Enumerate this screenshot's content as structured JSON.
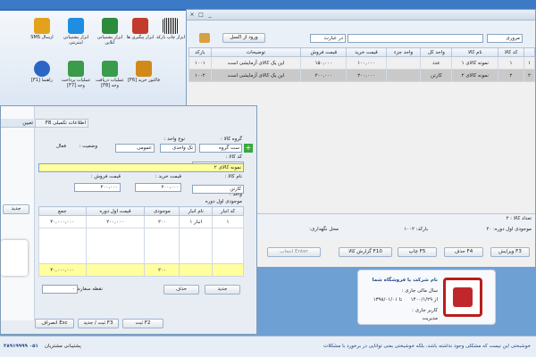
{
  "ribbon": {
    "items": [
      {
        "label": "ابزار پشتیبانی اینترنتی",
        "icon": "teamviewer-icon",
        "color": "#1f8de0"
      },
      {
        "label": "ارسال SMS",
        "icon": "sms-icon",
        "color": "#e3a21b"
      },
      {
        "label": "ابزار پشتیبانی آنلاین",
        "icon": "support-icon",
        "color": "#2c8b3c"
      },
      {
        "label": "ابزار پیگیری ها",
        "icon": "calendar-icon",
        "color": "#c23b2b"
      },
      {
        "label": "ابزار چاپ بارکد",
        "icon": "barcode-icon",
        "color": "#333333"
      },
      {
        "label": "راهنما [F1]",
        "icon": "help-icon",
        "color": "#2b66c4"
      },
      {
        "label": "عملیات پرداخت وجه [F7]",
        "icon": "payment-icon",
        "color": "#3a9b4a"
      },
      {
        "label": "عملیات دریافت وجه [F8]",
        "icon": "receive-icon",
        "color": "#3a9b4a"
      },
      {
        "label": "فاکتور خرید [F6]",
        "icon": "invoice-icon",
        "color": "#d08a1a"
      }
    ]
  },
  "main": {
    "window_controls": {
      "min": "_",
      "max": "□",
      "close": "×"
    },
    "search_field": "مروری",
    "search_op": "در عبارت",
    "export_button": "ورود از اکسل",
    "columns": [
      "کد کالا",
      "نام کالا",
      "واحد کل",
      "واحد جزء",
      "قیمت خرید",
      "قیمت فروش",
      "توضیحات",
      "بارکد"
    ],
    "rows": [
      {
        "num": "۱",
        "code": "۱",
        "name": "نمونه کالای ۱",
        "unit": "عدد",
        "unit_part": "",
        "buy": "۱۰۰,۰۰۰",
        "sell": "۱۵۰,۰۰۰",
        "desc": "این یک کالای آزمایشی است",
        "barcode": "۱۰۰۱"
      },
      {
        "num": "۲",
        "code": "۲",
        "name": "نمونه کالای ۲",
        "unit": "کارتن",
        "unit_part": "",
        "buy": "۲۰۰,۰۰۰",
        "sell": "۲۰۰,۰۰۰",
        "desc": "این یک کالای آزمایشی است",
        "barcode": "۱۰۰۲"
      }
    ],
    "count_label": "تعداد کالا : ۲",
    "stock_label": "موجودی اول دوره: ۲۰",
    "barcode_label": "بارکد: ۱۰۰۲",
    "storage_label": "محل نگهداری:",
    "actions": [
      "ویرایش F3",
      "حذف F4",
      "چاپ F5",
      "گزارش کالا F10",
      "انتخاب Enter"
    ]
  },
  "company": {
    "name": "نام شرکت یا فروشگاه شما",
    "fiscal_year": "سال مالی جاری :",
    "date_from": "از ۱۴۰۰/۱/۲۹",
    "date_to": "تا ۱۳۹۸/۰۱/۰۱",
    "user_label": "کاربر جاری :",
    "user": "مدیریت"
  },
  "dialog": {
    "tab_tech": "اطلاعات تکمیلی F8",
    "tab_extra": "تعیین",
    "group_label": "گروه کالا :",
    "group_value": "ست گروه",
    "unit_type_label": "نوع واحد :",
    "unit_type_value": "تک واحدی",
    "status_label": "وضعیت :",
    "status_value": "فعال",
    "public_value": "عمومی",
    "name_label": "نام کالا :",
    "name_value": "نمونه کالای ۲",
    "code_label": "کد کالا :",
    "code_value": "۲",
    "unit_label": "واحد :",
    "unit_value": "کارتن",
    "buy_label": "قیمت خرید :",
    "buy_value": "۲۰۰,۰۰۰",
    "sell_label": "قیمت فروش :",
    "sell_value": "۲۰۰,۰۰۰",
    "stock_title": "موجودی اول دوره",
    "stock_columns": [
      "کد انبار",
      "نام انبار",
      "موجودی",
      "قیمت اول دوره",
      "جمع"
    ],
    "stock_rows": [
      {
        "code": "۱",
        "name": "انبار ۱",
        "qty": "۲۰۰",
        "price": "۲۰۰,۰۰۰",
        "total": "۴۰,۰۰۰,۰۰۰"
      }
    ],
    "stock_total_qty": "۲۰۰",
    "stock_total": "۴۰,۰۰۰,۰۰۰",
    "order_point_label": "نقطه سفارش :",
    "order_point_value": "۰",
    "new_button": "جدید",
    "delete_button": "حذف",
    "save_button": "ثبت F2",
    "save_new_button": "ثبت / جدید F3",
    "cancel_button": "انصراف Esc",
    "side_new_button": "جدید"
  },
  "footer": {
    "support_text": "پشتیبانی مشتریان",
    "phone": "۰۵۱ ۳۸۹۱۹۹۹۹",
    "slogan": "خوشبختی این نیست که مشکلی وجود نداشته باشد، بلکه خوشبختی یعنی توانایی در برخورد با مشکلات"
  }
}
